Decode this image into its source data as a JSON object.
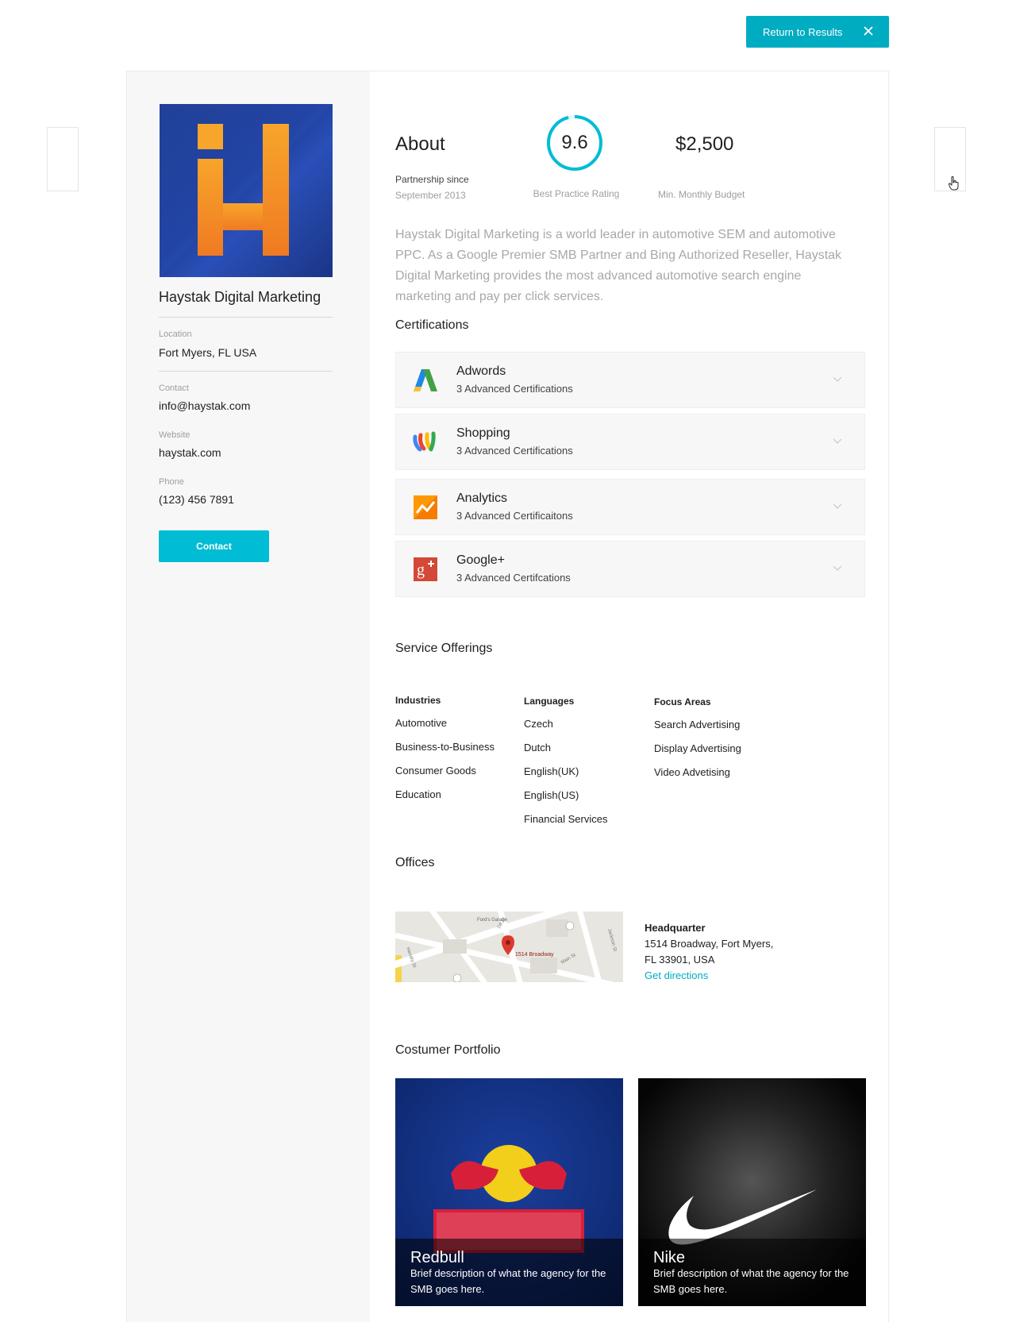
{
  "header": {
    "return_label": "Return to Results"
  },
  "company": {
    "name": "Haystak Digital Marketing",
    "location_label": "Location",
    "location": "Fort Myers, FL USA",
    "contact_label": "Contact",
    "contact": "info@haystak.com",
    "website_label": "Website",
    "website": "haystak.com",
    "phone_label": "Phone",
    "phone": "(123) 456 7891",
    "contact_button": "Contact"
  },
  "about": {
    "title": "About",
    "partnership_label": "Partnership since",
    "partnership_value": "September 2013",
    "rating": "9.6",
    "rating_fraction": 0.96,
    "rating_label": "Best Practice Rating",
    "budget": "$2,500",
    "budget_label": "Min. Monthly Budget",
    "description": "Haystak Digital Marketing is a world leader in automotive SEM and automotive PPC. As a Google Premier SMB Partner and Bing Authorized Reseller, Haystak Digital Marketing provides the most advanced automotive search engine marketing and pay per click services."
  },
  "certifications": {
    "title": "Certifications",
    "items": [
      {
        "name": "Adwords",
        "sub": "3 Advanced Certifications",
        "icon": "adwords-icon"
      },
      {
        "name": "Shopping",
        "sub": "3 Advanced Certifications",
        "icon": "shopping-icon"
      },
      {
        "name": "Analytics",
        "sub": "3 Advanced Certificaitons",
        "icon": "analytics-icon"
      },
      {
        "name": "Google+",
        "sub": "3 Advanced Certifcations",
        "icon": "google-plus-icon"
      }
    ]
  },
  "services": {
    "title": "Service Offerings",
    "industries": {
      "head": "Industries",
      "items": [
        "Automotive",
        "Business-to-Business",
        "Consumer Goods",
        "Education"
      ]
    },
    "languages": {
      "head": "Languages",
      "items": [
        "Czech",
        "Dutch",
        "English(UK)",
        "English(US)",
        "Financial Services"
      ]
    },
    "focus": {
      "head": "Focus Areas",
      "items": [
        "Search Advertising",
        "Display Advertising",
        "Video Advetising"
      ]
    }
  },
  "offices": {
    "title": "Offices",
    "map_label": "1514 Broadway",
    "map_place": "Ford's Garage",
    "street_1st": "1st St",
    "street_hendry": "Hendry St",
    "street_main": "Main St",
    "street_jackson": "Jackson St",
    "hq_title": "Headquarter",
    "hq_line1": "1514 Broadway, Fort Myers,",
    "hq_line2": "FL 33901, USA",
    "directions": "Get directions"
  },
  "portfolio": {
    "title": "Costumer Portfolio",
    "items": [
      {
        "name": "Redbull",
        "desc": "Brief description of what the agency for the SMB goes here."
      },
      {
        "name": "Nike",
        "desc": "Brief description of what the agency for the SMB goes here."
      }
    ]
  },
  "colors": {
    "accent": "#00acc1",
    "button": "#00bcd4"
  }
}
